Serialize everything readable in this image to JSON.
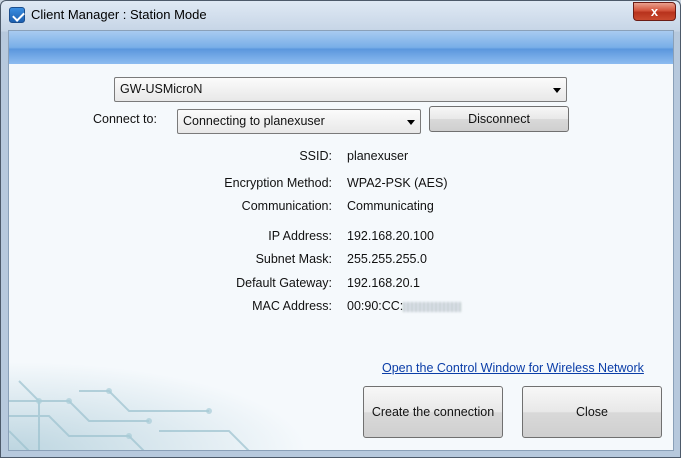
{
  "window": {
    "title": "Client Manager : Station Mode",
    "close_label": "x"
  },
  "adapter_select": {
    "value": "GW-USMicroN"
  },
  "connect": {
    "label": "Connect to:",
    "value": "Connecting to planexuser",
    "disconnect_label": "Disconnect"
  },
  "info": {
    "ssid": {
      "label": "SSID:",
      "value": "planexuser"
    },
    "encryption": {
      "label": "Encryption Method:",
      "value": "WPA2-PSK (AES)"
    },
    "communication": {
      "label": "Communication:",
      "value": "Communicating"
    },
    "ip": {
      "label": "IP Address:",
      "value": "192.168.20.100"
    },
    "subnet": {
      "label": "Subnet Mask:",
      "value": "255.255.255.0"
    },
    "gateway": {
      "label": "Default Gateway:",
      "value": "192.168.20.1"
    },
    "mac": {
      "label": "MAC Address:",
      "value": "00:90:CC:"
    }
  },
  "link_text": "Open the Control Window for Wireless Network",
  "buttons": {
    "create": "Create the connection",
    "close": "Close"
  }
}
